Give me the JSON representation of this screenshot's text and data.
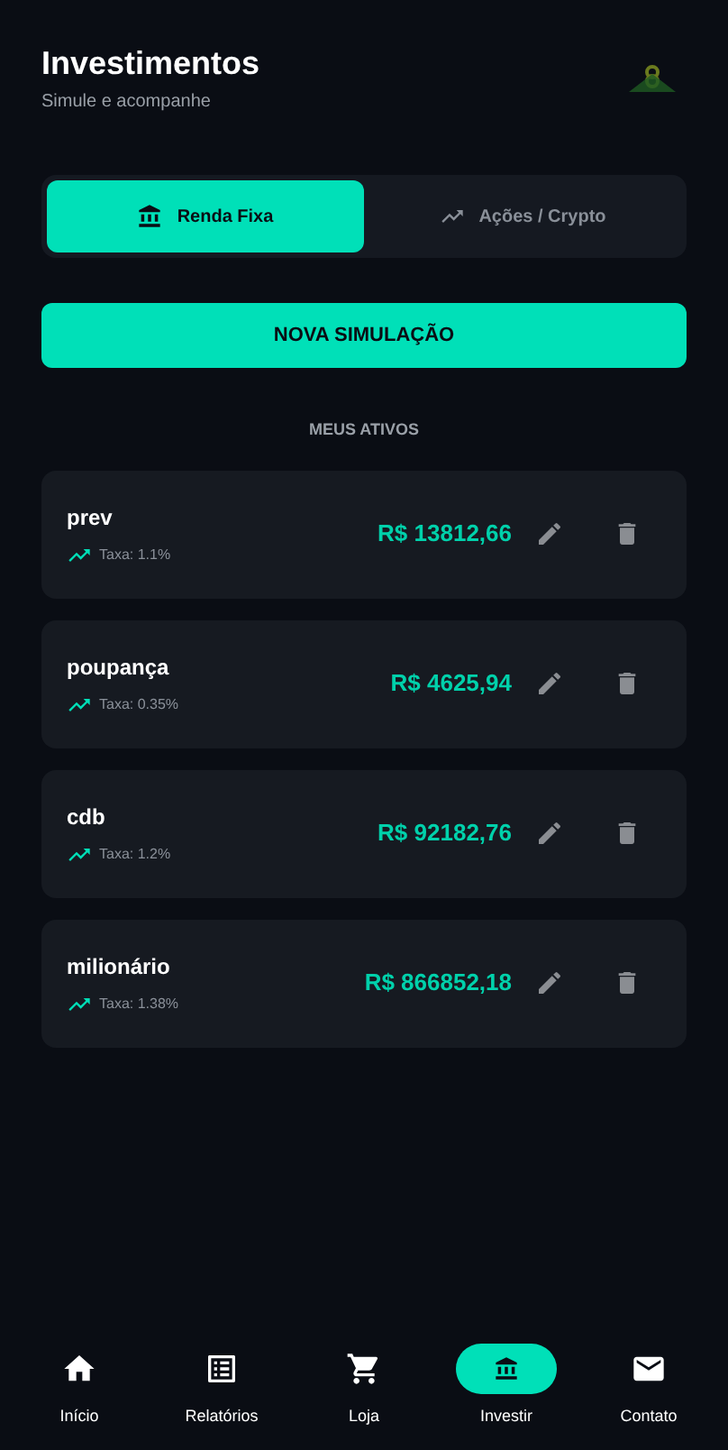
{
  "header": {
    "title": "Investimentos",
    "subtitle": "Simule e acompanhe"
  },
  "tabs": [
    {
      "label": "Renda Fixa",
      "selected": true
    },
    {
      "label": "Ações / Crypto",
      "selected": false
    }
  ],
  "new_button": "NOVA SIMULAÇÃO",
  "section_title": "MEUS ATIVOS",
  "assets": [
    {
      "name": "prev",
      "rate": "Taxa: 1.1%",
      "value": "R$ 13812,66"
    },
    {
      "name": "poupança",
      "rate": "Taxa: 0.35%",
      "value": "R$ 4625,94"
    },
    {
      "name": "cdb",
      "rate": "Taxa: 1.2%",
      "value": "R$ 92182,76"
    },
    {
      "name": "milionário",
      "rate": "Taxa: 1.38%",
      "value": "R$ 866852,18"
    }
  ],
  "nav": [
    {
      "label": "Início",
      "selected": false
    },
    {
      "label": "Relatórios",
      "selected": false
    },
    {
      "label": "Loja",
      "selected": false
    },
    {
      "label": "Investir",
      "selected": true
    },
    {
      "label": "Contato",
      "selected": false
    }
  ]
}
